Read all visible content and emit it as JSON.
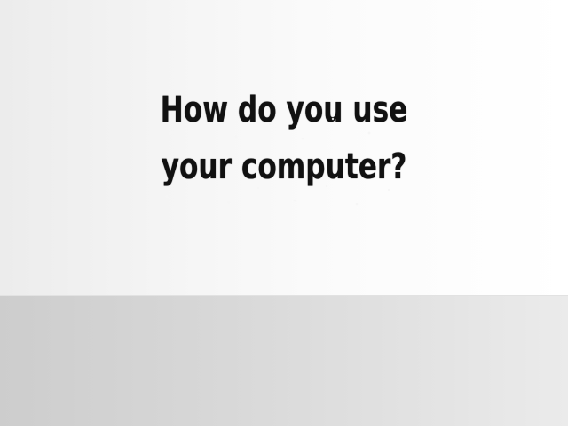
{
  "slide": {
    "headline_line1": "How do you use",
    "headline_line2": "your computer?"
  },
  "colors": {
    "text": "#111111",
    "upper_background": "#f6f6f6",
    "lower_background": "#d8d8d8"
  }
}
